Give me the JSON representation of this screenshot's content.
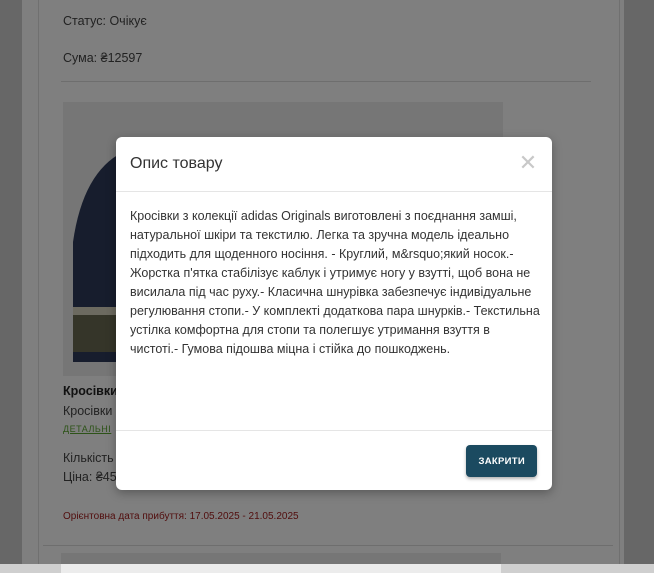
{
  "order": {
    "status": "Статус: Очікує",
    "sum": "Сума: ₴12597"
  },
  "product": {
    "name": "Кросівки",
    "description": "Кросівки",
    "details_link": "ДЕТАЛЬНІ",
    "quantity": "Кількість",
    "price": "Ціна: ₴45",
    "eta": "Орієнтовна дата прибуття: 17.05.2025 - 21.05.2025"
  },
  "modal": {
    "title": "Опис товару",
    "close_icon": "close-icon",
    "body": "Кросівки з колекції adidas Originals виготовлені з поєднання замші, натуральної шкіри та текстилю. Легка та зручна модель ідеально підходить для щоденного носіння. - Круглий, м&rsquo;який носок.- Жорстка п'ятка стабілізує каблук і утримує ногу у взутті, щоб вона не висилала під час руху.- Класична шнурівка забезпечує індивідуальне регулювання стопи.- У комплекті додаткова пара шнурків.- Текстильна устілка комфортна для стопи та полегшує утримання взуття в чистоті.- Гумова підошва міцна і стійка до пошкоджень.",
    "close_button": "ЗАКРИТИ"
  },
  "colors": {
    "primary_button": "#1b4a60",
    "eta_text": "#a31d1d",
    "link": "#5aa630"
  }
}
